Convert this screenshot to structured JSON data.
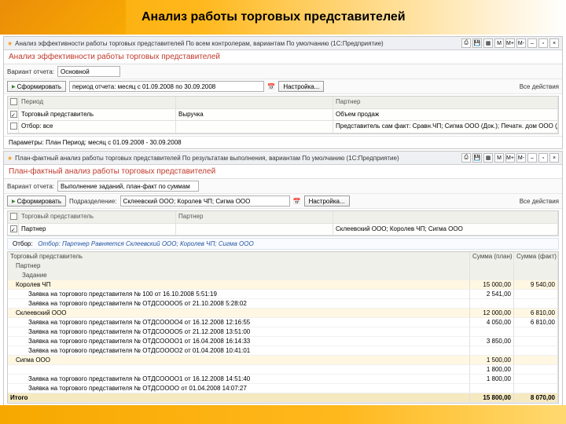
{
  "page_title": "Анализ работы торговых представителей",
  "win1": {
    "title": "Анализ эффективности работы торговых представителей   По всем контролерам, вариантам   По умолчанию  (1С:Предприятие)",
    "subtitle": "Анализ эффективности работы торговых представителей",
    "variant_lbl": "Вариант отчета:",
    "variant_val": "Основной",
    "form_btn": "Сформировать",
    "period": "период отчета: месяц с 01.09.2008 по 30.09.2008",
    "nastr": "Настройка...",
    "all": "Все действия",
    "hdr": {
      "c1": "Период",
      "c2": "",
      "c3": "Партнер",
      "c4": "Объем продаж"
    },
    "r1": {
      "c1": "Торговый представитель",
      "c2": "Выручка",
      "c4": ""
    },
    "r2": {
      "c1": "Отбор: все",
      "c4": "Представитель сам факт: Сравн.ЧП; Сигма ООО (Док.); Печатн. дом ООО (Док.)..."
    },
    "param": "Параметры: План   Период: месяц с 01.09.2008 - 30.09.2008"
  },
  "win2": {
    "title": "План-фактный анализ работы торговых представителей   По результатам выполнения, вариантам   По умолчанию  (1С:Предприятие)",
    "subtitle": "План-фактный анализ работы торговых представителей",
    "variant_lbl": "Вариант отчета:",
    "variant_val": "Выполнение заданий, план-факт по суммам",
    "form_btn": "Сформировать",
    "podr": "Подразделение:",
    "podr_val": "Склеевский ООО; Королев ЧП; Сигма ООО",
    "nastr": "Настройка...",
    "all": "Все действия",
    "hdr": {
      "c1": "Торговый представитель",
      "c2": "Партнер",
      "c4": ""
    },
    "r1": {
      "c1": "Партнер",
      "c2": "",
      "c4": "Склеевский ООО; Королев ЧП; Сигма ООО"
    },
    "filter": "Отбор:   Партнер Равняется Склеевский ООО; Королев ЧП; Сигма ООО",
    "cols": {
      "c1": "Торговый представитель",
      "c2": "Сумма (план)",
      "c3": "Сумма (факт)"
    },
    "sub1": "Партнер",
    "sub2": "Задание",
    "rows": [
      {
        "l": 1,
        "t": "Королев ЧП",
        "p": "15 000,00",
        "f": "9 540,00"
      },
      {
        "l": 2,
        "t": "Заявка на торгового представителя № 100  от 16.10.2008 5:51:19",
        "p": "2 541,00",
        "f": ""
      },
      {
        "l": 2,
        "t": "Заявка на торгового представителя № ОТДСОООО5 от 21.10.2008 5:28:02",
        "p": "",
        "f": ""
      },
      {
        "l": 1,
        "t": "Склеевский ООО",
        "p": "12 000,00",
        "f": "6 810,00"
      },
      {
        "l": 2,
        "t": "Заявка на торгового представителя № ОТДСОООО4 от 16.12.2008 12:16:55",
        "p": "4 050,00",
        "f": "6 810,00"
      },
      {
        "l": 2,
        "t": "Заявка на торгового представителя № ОТДСОООО5 от 21.12.2008 13:51:00",
        "p": "",
        "f": ""
      },
      {
        "l": 2,
        "t": "Заявка на торгового представителя № ОТДСОООО1 от 16.04.2008 16:14:33",
        "p": "3 850,00",
        "f": ""
      },
      {
        "l": 2,
        "t": "Заявка на торгового представителя № ОТДСОООО2 от 01.04.2008 10:41:01",
        "p": "",
        "f": ""
      },
      {
        "l": 1,
        "t": "Сигма ООО",
        "p": "1 500,00",
        "f": ""
      },
      {
        "l": 2,
        "t": "",
        "p": "1 800,00",
        "f": ""
      },
      {
        "l": 2,
        "t": "Заявка на торгового представителя № ОТДСОООО1 от 16.12.2008 14:51:40",
        "p": "1 800,00",
        "f": ""
      },
      {
        "l": 2,
        "t": "Заявка на торгового представителя № ОТДСОООО от 01.04.2008 14:07:27",
        "p": "",
        "f": ""
      }
    ],
    "total": {
      "t": "Итого",
      "p": "15 800,00",
      "f": "8 070,00"
    }
  },
  "tb": {
    "m": "M",
    "mp": "M+",
    "mm": "M-",
    "min": "–",
    "max": "▫",
    "cls": "×"
  }
}
